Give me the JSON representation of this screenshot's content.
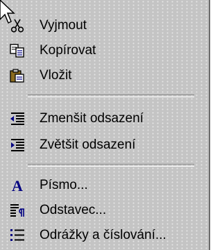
{
  "menu": {
    "items": [
      {
        "icon": "cut-icon",
        "label": "Vyjmout"
      },
      {
        "icon": "copy-icon",
        "label": "Kopírovat"
      },
      {
        "icon": "paste-icon",
        "label": "Vložit"
      },
      {
        "icon": "decrease-indent-icon",
        "label": "Zmenšit odsazení"
      },
      {
        "icon": "increase-indent-icon",
        "label": "Zvětšit odsazení"
      },
      {
        "icon": "font-icon",
        "label": "Písmo..."
      },
      {
        "icon": "paragraph-icon",
        "label": "Odstavec..."
      },
      {
        "icon": "bullets-numbering-icon",
        "label": "Odrážky a číslování..."
      }
    ]
  }
}
